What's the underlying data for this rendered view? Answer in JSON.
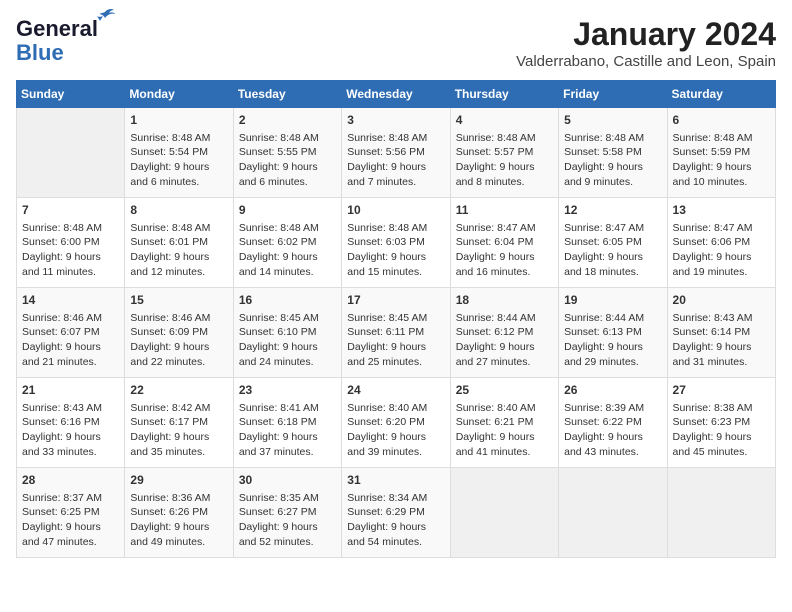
{
  "logo": {
    "part1": "General",
    "part2": "Blue"
  },
  "title": "January 2024",
  "location": "Valderrabano, Castille and Leon, Spain",
  "days_header": [
    "Sunday",
    "Monday",
    "Tuesday",
    "Wednesday",
    "Thursday",
    "Friday",
    "Saturday"
  ],
  "weeks": [
    [
      {
        "day": "",
        "info": ""
      },
      {
        "day": "1",
        "info": "Sunrise: 8:48 AM\nSunset: 5:54 PM\nDaylight: 9 hours\nand 6 minutes."
      },
      {
        "day": "2",
        "info": "Sunrise: 8:48 AM\nSunset: 5:55 PM\nDaylight: 9 hours\nand 6 minutes."
      },
      {
        "day": "3",
        "info": "Sunrise: 8:48 AM\nSunset: 5:56 PM\nDaylight: 9 hours\nand 7 minutes."
      },
      {
        "day": "4",
        "info": "Sunrise: 8:48 AM\nSunset: 5:57 PM\nDaylight: 9 hours\nand 8 minutes."
      },
      {
        "day": "5",
        "info": "Sunrise: 8:48 AM\nSunset: 5:58 PM\nDaylight: 9 hours\nand 9 minutes."
      },
      {
        "day": "6",
        "info": "Sunrise: 8:48 AM\nSunset: 5:59 PM\nDaylight: 9 hours\nand 10 minutes."
      }
    ],
    [
      {
        "day": "7",
        "info": "Sunrise: 8:48 AM\nSunset: 6:00 PM\nDaylight: 9 hours\nand 11 minutes."
      },
      {
        "day": "8",
        "info": "Sunrise: 8:48 AM\nSunset: 6:01 PM\nDaylight: 9 hours\nand 12 minutes."
      },
      {
        "day": "9",
        "info": "Sunrise: 8:48 AM\nSunset: 6:02 PM\nDaylight: 9 hours\nand 14 minutes."
      },
      {
        "day": "10",
        "info": "Sunrise: 8:48 AM\nSunset: 6:03 PM\nDaylight: 9 hours\nand 15 minutes."
      },
      {
        "day": "11",
        "info": "Sunrise: 8:47 AM\nSunset: 6:04 PM\nDaylight: 9 hours\nand 16 minutes."
      },
      {
        "day": "12",
        "info": "Sunrise: 8:47 AM\nSunset: 6:05 PM\nDaylight: 9 hours\nand 18 minutes."
      },
      {
        "day": "13",
        "info": "Sunrise: 8:47 AM\nSunset: 6:06 PM\nDaylight: 9 hours\nand 19 minutes."
      }
    ],
    [
      {
        "day": "14",
        "info": "Sunrise: 8:46 AM\nSunset: 6:07 PM\nDaylight: 9 hours\nand 21 minutes."
      },
      {
        "day": "15",
        "info": "Sunrise: 8:46 AM\nSunset: 6:09 PM\nDaylight: 9 hours\nand 22 minutes."
      },
      {
        "day": "16",
        "info": "Sunrise: 8:45 AM\nSunset: 6:10 PM\nDaylight: 9 hours\nand 24 minutes."
      },
      {
        "day": "17",
        "info": "Sunrise: 8:45 AM\nSunset: 6:11 PM\nDaylight: 9 hours\nand 25 minutes."
      },
      {
        "day": "18",
        "info": "Sunrise: 8:44 AM\nSunset: 6:12 PM\nDaylight: 9 hours\nand 27 minutes."
      },
      {
        "day": "19",
        "info": "Sunrise: 8:44 AM\nSunset: 6:13 PM\nDaylight: 9 hours\nand 29 minutes."
      },
      {
        "day": "20",
        "info": "Sunrise: 8:43 AM\nSunset: 6:14 PM\nDaylight: 9 hours\nand 31 minutes."
      }
    ],
    [
      {
        "day": "21",
        "info": "Sunrise: 8:43 AM\nSunset: 6:16 PM\nDaylight: 9 hours\nand 33 minutes."
      },
      {
        "day": "22",
        "info": "Sunrise: 8:42 AM\nSunset: 6:17 PM\nDaylight: 9 hours\nand 35 minutes."
      },
      {
        "day": "23",
        "info": "Sunrise: 8:41 AM\nSunset: 6:18 PM\nDaylight: 9 hours\nand 37 minutes."
      },
      {
        "day": "24",
        "info": "Sunrise: 8:40 AM\nSunset: 6:20 PM\nDaylight: 9 hours\nand 39 minutes."
      },
      {
        "day": "25",
        "info": "Sunrise: 8:40 AM\nSunset: 6:21 PM\nDaylight: 9 hours\nand 41 minutes."
      },
      {
        "day": "26",
        "info": "Sunrise: 8:39 AM\nSunset: 6:22 PM\nDaylight: 9 hours\nand 43 minutes."
      },
      {
        "day": "27",
        "info": "Sunrise: 8:38 AM\nSunset: 6:23 PM\nDaylight: 9 hours\nand 45 minutes."
      }
    ],
    [
      {
        "day": "28",
        "info": "Sunrise: 8:37 AM\nSunset: 6:25 PM\nDaylight: 9 hours\nand 47 minutes."
      },
      {
        "day": "29",
        "info": "Sunrise: 8:36 AM\nSunset: 6:26 PM\nDaylight: 9 hours\nand 49 minutes."
      },
      {
        "day": "30",
        "info": "Sunrise: 8:35 AM\nSunset: 6:27 PM\nDaylight: 9 hours\nand 52 minutes."
      },
      {
        "day": "31",
        "info": "Sunrise: 8:34 AM\nSunset: 6:29 PM\nDaylight: 9 hours\nand 54 minutes."
      },
      {
        "day": "",
        "info": ""
      },
      {
        "day": "",
        "info": ""
      },
      {
        "day": "",
        "info": ""
      }
    ]
  ]
}
